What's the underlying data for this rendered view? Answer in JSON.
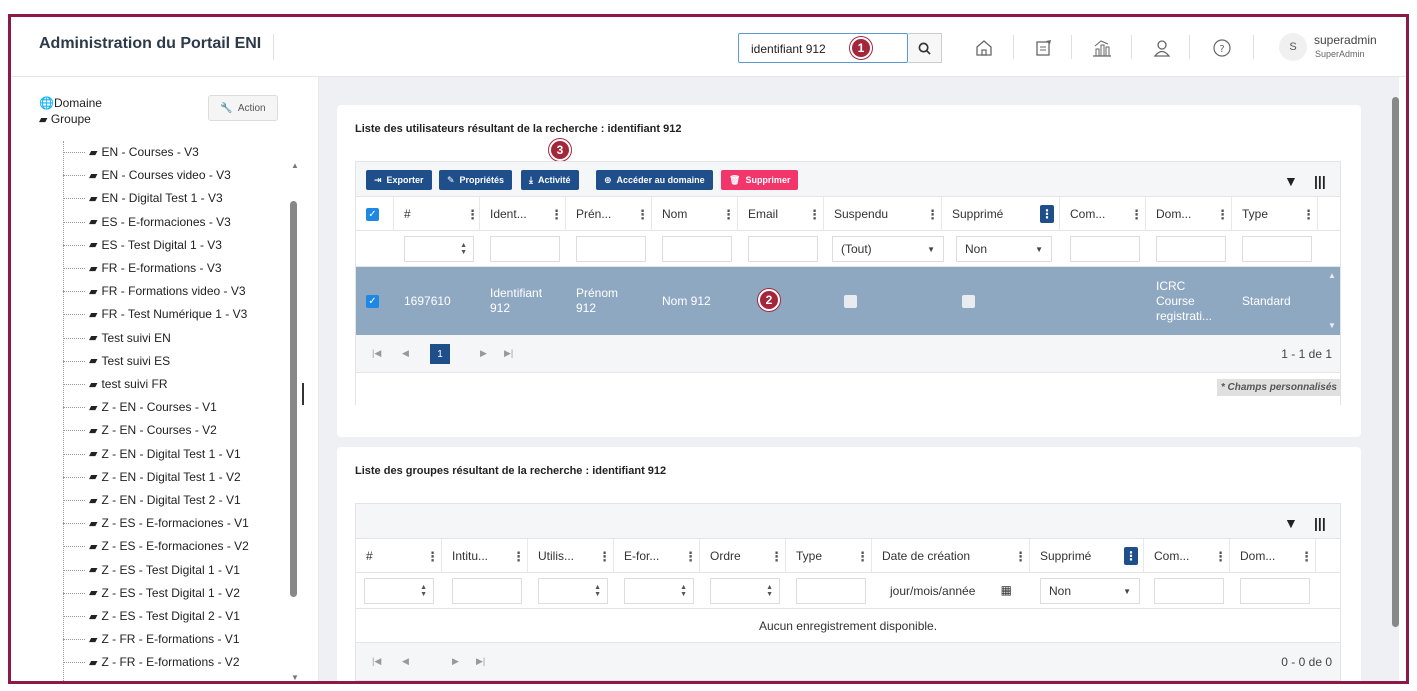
{
  "app": {
    "title": "Administration du Portail ENI"
  },
  "search": {
    "value": "identifiant 912"
  },
  "badges": {
    "b1": "1",
    "b2": "2",
    "b3": "3"
  },
  "user": {
    "initial": "S",
    "name": "superadmin",
    "role": "SuperAdmin"
  },
  "sidebar": {
    "domain_label": "Domaine",
    "group_label": "Groupe",
    "action_label": "Action",
    "items": [
      "EN - Courses - V3",
      "EN - Courses video - V3",
      "EN - Digital Test 1 - V3",
      "ES - E-formaciones - V3",
      "ES - Test Digital 1 - V3",
      "FR - E-formations - V3",
      "FR - Formations video - V3",
      "FR - Test Numérique 1 - V3",
      "Test suivi EN",
      "Test suivi ES",
      "test suivi FR",
      "Z - EN - Courses - V1",
      "Z - EN - Courses - V2",
      "Z - EN - Digital Test 1 - V1",
      "Z - EN - Digital Test 1 - V2",
      "Z - EN - Digital Test 2 - V1",
      "Z - ES - E-formaciones - V1",
      "Z - ES - E-formaciones - V2",
      "Z - ES - Test Digital 1 - V1",
      "Z - ES - Test Digital 1 - V2",
      "Z - ES - Test Digital 2 - V1",
      "Z - FR - E-formations - V1",
      "Z - FR - E-formations - V2"
    ]
  },
  "users_panel": {
    "title": "Liste des utilisateurs résultant de la recherche : identifiant 912",
    "toolbar": {
      "export": "Exporter",
      "properties": "Propriétés",
      "activity": "Activité",
      "access_domain": "Accéder au domaine",
      "delete": "Supprimer"
    },
    "columns": [
      "#",
      "Ident...",
      "Prén...",
      "Nom",
      "Email",
      "Suspendu",
      "Supprimé",
      "Com...",
      "Dom...",
      "Type"
    ],
    "filters": {
      "suspendu": "(Tout)",
      "supprime": "Non"
    },
    "row": {
      "id": "1697610",
      "ident_1": "Identifiant",
      "ident_2": "912",
      "prenom_1": "Prénom",
      "prenom_2": "912",
      "nom": "Nom 912",
      "dom_1": "ICRC",
      "dom_2": "Course",
      "dom_3": "registrati...",
      "type": "Standard"
    },
    "pager": {
      "page": "1",
      "summary": "1 - 1 de 1"
    },
    "custom_fields_note": "* Champs personnalisés"
  },
  "groups_panel": {
    "title": "Liste des groupes résultant de la recherche : identifiant 912",
    "columns": [
      "#",
      "Intitu...",
      "Utilis...",
      "E-for...",
      "Ordre",
      "Type",
      "Date de création",
      "Supprimé",
      "Com...",
      "Dom..."
    ],
    "filters": {
      "date_placeholder": "jour/mois/année",
      "supprime": "Non"
    },
    "empty": "Aucun enregistrement disponible.",
    "pager": {
      "summary": "0 - 0 de 0"
    }
  },
  "colors": {
    "frame": "#8b1a47",
    "badge": "#a3263b",
    "primary": "#1f4f8b",
    "danger": "#f2356b",
    "selected_row": "#8fa8c2"
  }
}
